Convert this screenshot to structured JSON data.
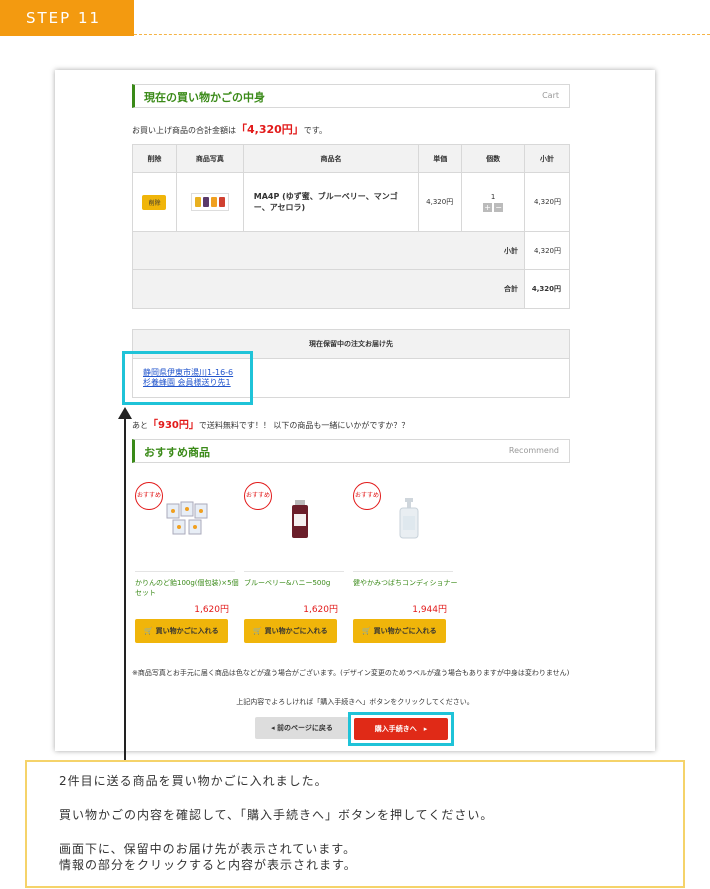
{
  "step": {
    "label": "STEP 11"
  },
  "cart": {
    "title": "現在の買い物かごの中身",
    "title_en": "Cart",
    "total_prefix": "お買い上げ商品の合計金額は",
    "total_amount": "「4,320円」",
    "total_suffix": "です。",
    "headers": [
      "削除",
      "商品写真",
      "商品名",
      "単価",
      "個数",
      "小計"
    ],
    "item": {
      "delete_label": "削除",
      "name": "MA4P (ゆず蜜、ブルーベリー、マンゴー、アセロラ)",
      "unit_price": "4,320円",
      "quantity": "1",
      "plus": "+",
      "minus": "−",
      "subtotal": "4,320円"
    },
    "subtotal_label": "小計",
    "subtotal_value": "4,320円",
    "total_label": "合計",
    "total_value": "4,320円"
  },
  "address": {
    "header": "現在保留中の注文お届け先",
    "line1": "静岡県伊東市湯川1-16-6",
    "line2": "杉養蜂園 会員様送り先1"
  },
  "shipping_msg": {
    "prefix": "あと",
    "amount": "「930円」",
    "suffix": "で送料無料です！！ 以下の商品も一緒にいかがですか？？"
  },
  "recommend": {
    "title": "おすすめ商品",
    "title_en": "Recommend",
    "badge": "おすすめ",
    "button_label": "買い物かごに入れる",
    "items": [
      {
        "name": "かりんのど飴100g(個包装)×5個セット",
        "price": "1,620円"
      },
      {
        "name": "ブルーベリー&ハニー500g",
        "price": "1,620円"
      },
      {
        "name": "健やかみつばちコンディショナー",
        "price": "1,944円"
      }
    ]
  },
  "notes": {
    "disclaimer": "※商品写真とお手元に届く商品は色などが違う場合がございます。(デザイン変更のためラベルが違う場合もありますが中身は変わりません)",
    "confirm": "上記内容でよろしければ「購入手続きへ」ボタンをクリックしてください。"
  },
  "buttons": {
    "back": "◂ 前のページに戻る",
    "proceed": "購入手続きへ　▸"
  },
  "instructions": {
    "line1": "2件目に送る商品を買い物かごに入れました。",
    "line2": "買い物かごの内容を確認して、「購入手続きへ」ボタンを押してください。",
    "line3": "画面下に、保留中のお届け先が表示されています。",
    "line4": "情報の部分をクリックすると内容が表示されます。"
  },
  "colors": {
    "orange": "#f39a10",
    "green": "#3a8a18",
    "red": "#e21a1a",
    "cyan_highlight": "#1fc3d8",
    "yellow_button": "#f0b50a",
    "info_border": "#f5d36a"
  }
}
